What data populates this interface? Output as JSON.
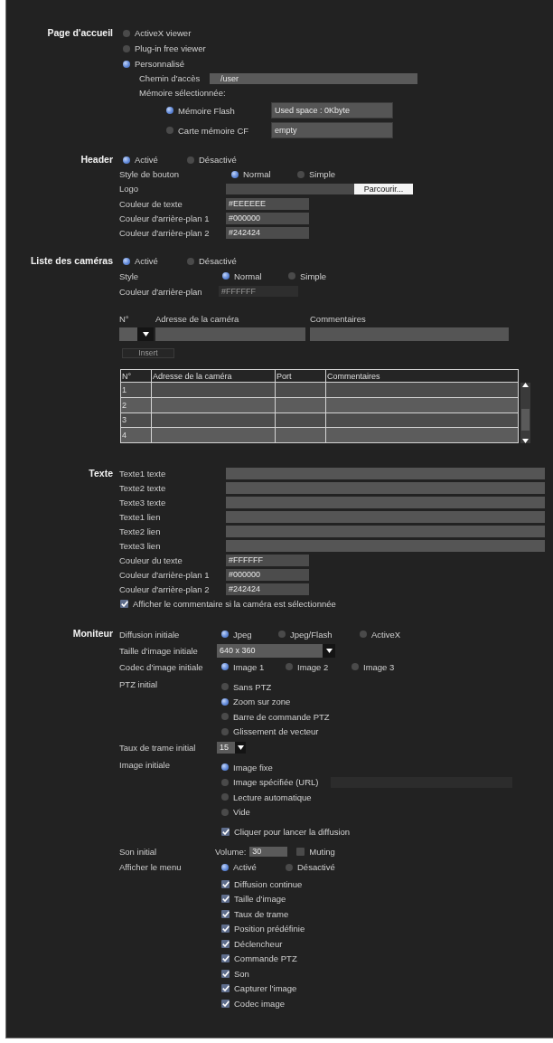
{
  "homepage": {
    "label": "Page d'accueil",
    "options": [
      {
        "label": "ActiveX viewer",
        "selected": false
      },
      {
        "label": "Plug-in free viewer",
        "selected": false
      },
      {
        "label": "Personnalisé",
        "selected": true
      }
    ],
    "path": {
      "label": "Chemin d'accès",
      "value": "/user"
    },
    "memory": {
      "label": "Mémoire sélectionnée:",
      "options": [
        {
          "label": "Mémoire Flash",
          "selected": true,
          "value": "Used space : 0Kbyte"
        },
        {
          "label": "Carte mémoire CF",
          "selected": false,
          "value": "empty"
        }
      ]
    }
  },
  "header": {
    "label": "Header",
    "options": [
      {
        "label": "Activé",
        "selected": true
      },
      {
        "label": "Désactivé",
        "selected": false
      }
    ],
    "button_style": {
      "label": "Style de bouton",
      "options": [
        {
          "label": "Normal",
          "selected": true
        },
        {
          "label": "Simple",
          "selected": false
        }
      ]
    },
    "logo": {
      "label": "Logo",
      "button": "Parcourir..."
    },
    "colors": [
      {
        "label": "Couleur de texte",
        "value": "#EEEEEE"
      },
      {
        "label": "Couleur d'arrière-plan 1",
        "value": "#000000"
      },
      {
        "label": "Couleur d'arrière-plan 2",
        "value": "#242424"
      }
    ]
  },
  "camera_list": {
    "label": "Liste des caméras",
    "options": [
      {
        "label": "Activé",
        "selected": true
      },
      {
        "label": "Désactivé",
        "selected": false
      }
    ],
    "style": {
      "label": "Style",
      "options": [
        {
          "label": "Normal",
          "selected": true
        },
        {
          "label": "Simple",
          "selected": false
        }
      ]
    },
    "background_color": {
      "label": "Couleur d'arrière-plan",
      "value": "#FFFFFF",
      "disabled": true
    },
    "entry": {
      "columns": [
        "N°",
        "Adresse de la caméra",
        "Commentaires"
      ],
      "insert_button": {
        "label": "Insert",
        "disabled": true
      }
    },
    "table": {
      "columns": [
        "N°",
        "Adresse de la caméra",
        "Port",
        "Commentaires"
      ],
      "rows": [
        {
          "number": "1"
        },
        {
          "number": "2"
        },
        {
          "number": "3"
        },
        {
          "number": "4"
        }
      ]
    }
  },
  "text": {
    "label": "Texte",
    "fields": [
      {
        "label": "Texte1 texte"
      },
      {
        "label": "Texte2 texte"
      },
      {
        "label": "Texte3 texte"
      },
      {
        "label": "Texte1 lien"
      },
      {
        "label": "Texte2 lien"
      },
      {
        "label": "Texte3 lien"
      }
    ],
    "colors": [
      {
        "label": "Couleur du texte",
        "value": "#FFFFFF"
      },
      {
        "label": "Couleur d'arrière-plan 1",
        "value": "#000000"
      },
      {
        "label": "Couleur d'arrière-plan 2",
        "value": "#242424"
      }
    ],
    "show_comment": {
      "label": "Afficher le commentaire si la caméra est sélectionnée",
      "checked": true
    }
  },
  "monitor": {
    "label": "Moniteur",
    "rows": [
      {
        "kind": "radio",
        "label": "Diffusion initiale",
        "options": [
          {
            "label": "Jpeg",
            "selected": true
          },
          {
            "label": "Jpeg/Flash",
            "selected": false
          },
          {
            "label": "ActiveX",
            "selected": false
          }
        ]
      },
      {
        "kind": "select",
        "label": "Taille d'image initiale",
        "value": "640 x 360"
      },
      {
        "kind": "radio",
        "label": "Codec d'image initiale",
        "options": [
          {
            "label": "Image 1",
            "selected": true
          },
          {
            "label": "Image 2",
            "selected": false
          },
          {
            "label": "Image 3",
            "selected": false
          }
        ]
      },
      {
        "kind": "radio_list",
        "label": "PTZ initial",
        "options": [
          {
            "kind": "plain",
            "label": "Sans PTZ",
            "selected": false
          },
          {
            "kind": "plain",
            "label": "Zoom sur zone",
            "selected": true
          },
          {
            "kind": "plain",
            "label": "Barre de commande PTZ",
            "selected": false
          },
          {
            "kind": "plain",
            "label": "Glissement de vecteur",
            "selected": false
          }
        ]
      },
      {
        "kind": "select",
        "label": "Taux de trame initial",
        "value": "15"
      },
      {
        "kind": "radio_list",
        "label": "Image initiale",
        "options": [
          {
            "kind": "plain",
            "label": "Image fixe",
            "selected": true
          },
          {
            "kind": "url",
            "label": "Image spécifiée (URL)",
            "selected": false
          },
          {
            "kind": "plain",
            "label": "Lecture automatique",
            "selected": false
          },
          {
            "kind": "plain",
            "label": "Vide",
            "selected": false
          }
        ]
      },
      {
        "kind": "checkbox",
        "checkbox": {
          "label": "Cliquer pour lancer la diffusion",
          "checked": true
        }
      },
      {
        "kind": "volume",
        "label": "Son initial",
        "volume_label": "Volume:",
        "value": "30",
        "muting": {
          "label": "Muting",
          "checked": false
        }
      },
      {
        "kind": "menu",
        "label": "Afficher le menu",
        "options": [
          {
            "label": "Activé",
            "selected": true
          },
          {
            "label": "Désactivé",
            "selected": false
          }
        ],
        "items": [
          {
            "label": "Diffusion continue",
            "checked": true
          },
          {
            "label": "Taille d'image",
            "checked": true
          },
          {
            "label": "Taux de trame",
            "checked": true
          },
          {
            "label": "Position prédéfinie",
            "checked": true
          },
          {
            "label": "Déclencheur",
            "checked": true
          },
          {
            "label": "Commande PTZ",
            "checked": true
          },
          {
            "label": "Son",
            "checked": true
          },
          {
            "label": "Capturer l'image",
            "checked": true
          },
          {
            "label": "Codec image",
            "checked": true
          }
        ]
      }
    ]
  }
}
